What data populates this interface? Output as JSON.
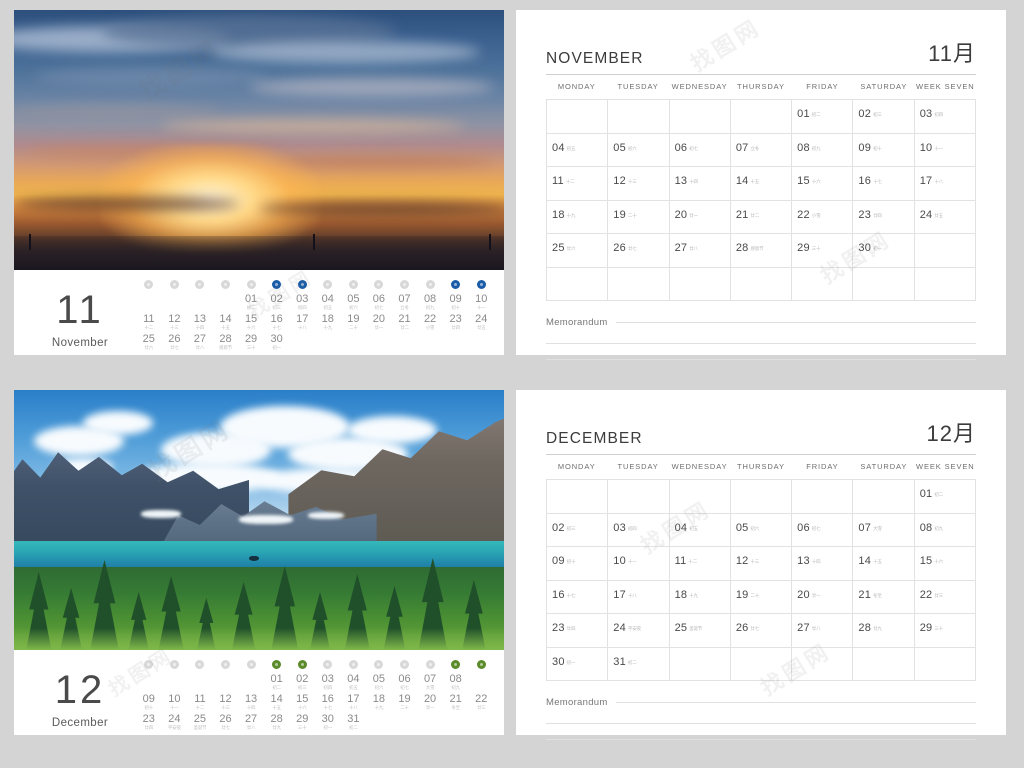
{
  "watermark": "找图网",
  "colors": {
    "november_accent": "#1a5ca8",
    "december_accent": "#5a8a2a",
    "background": "#d4d4d4",
    "page": "#ffffff",
    "text_dark": "#4a4a4a",
    "rule": "#e2e2e2"
  },
  "weekdays": [
    "MONDAY",
    "TUESDAY",
    "WEDNESDAY",
    "THURSDAY",
    "FRIDAY",
    "SATURDAY",
    "WEEK SEVEN"
  ],
  "memorandum_label": "Memorandum",
  "months": [
    {
      "key": "november",
      "number": "11",
      "name_en": "November",
      "title_en": "NOVEMBER",
      "title_cn": "11月",
      "accent": "#1a5ca8",
      "photo_alt": "sunset-sky-clouds",
      "grid_leading_blanks": 4,
      "grid_cells": [
        {
          "day": "",
          "lunar": ""
        },
        {
          "day": "",
          "lunar": ""
        },
        {
          "day": "",
          "lunar": ""
        },
        {
          "day": "",
          "lunar": ""
        },
        {
          "day": "01",
          "lunar": "初二"
        },
        {
          "day": "02",
          "lunar": "初三"
        },
        {
          "day": "03",
          "lunar": "初四"
        },
        {
          "day": "04",
          "lunar": "初五"
        },
        {
          "day": "05",
          "lunar": "初六"
        },
        {
          "day": "06",
          "lunar": "初七"
        },
        {
          "day": "07",
          "lunar": "立冬"
        },
        {
          "day": "08",
          "lunar": "初九"
        },
        {
          "day": "09",
          "lunar": "初十"
        },
        {
          "day": "10",
          "lunar": "十一"
        },
        {
          "day": "11",
          "lunar": "十二"
        },
        {
          "day": "12",
          "lunar": "十三"
        },
        {
          "day": "13",
          "lunar": "十四"
        },
        {
          "day": "14",
          "lunar": "十五"
        },
        {
          "day": "15",
          "lunar": "十六"
        },
        {
          "day": "16",
          "lunar": "十七"
        },
        {
          "day": "17",
          "lunar": "十八"
        },
        {
          "day": "18",
          "lunar": "十九"
        },
        {
          "day": "19",
          "lunar": "二十"
        },
        {
          "day": "20",
          "lunar": "廿一"
        },
        {
          "day": "21",
          "lunar": "廿二"
        },
        {
          "day": "22",
          "lunar": "小雪"
        },
        {
          "day": "23",
          "lunar": "廿四"
        },
        {
          "day": "24",
          "lunar": "廿五"
        },
        {
          "day": "25",
          "lunar": "廿六"
        },
        {
          "day": "26",
          "lunar": "廿七"
        },
        {
          "day": "27",
          "lunar": "廿八"
        },
        {
          "day": "28",
          "lunar": "感恩节"
        },
        {
          "day": "29",
          "lunar": "三十"
        },
        {
          "day": "30",
          "lunar": "初一"
        },
        {
          "day": "",
          "lunar": ""
        },
        {
          "day": "",
          "lunar": ""
        },
        {
          "day": "",
          "lunar": ""
        },
        {
          "day": "",
          "lunar": ""
        },
        {
          "day": "",
          "lunar": ""
        },
        {
          "day": "",
          "lunar": ""
        },
        {
          "day": "",
          "lunar": ""
        },
        {
          "day": "",
          "lunar": ""
        }
      ],
      "strip_dots": [
        false,
        false,
        false,
        false,
        false,
        true,
        true,
        false,
        false,
        false,
        false,
        false,
        true,
        true
      ],
      "strip_rows": [
        [
          {
            "day": "",
            "lunar": ""
          },
          {
            "day": "",
            "lunar": ""
          },
          {
            "day": "",
            "lunar": ""
          },
          {
            "day": "",
            "lunar": ""
          },
          {
            "day": "01",
            "lunar": "初二"
          },
          {
            "day": "02",
            "lunar": "初三"
          },
          {
            "day": "03",
            "lunar": "初四"
          },
          {
            "day": "04",
            "lunar": "初五"
          },
          {
            "day": "05",
            "lunar": "初六"
          },
          {
            "day": "06",
            "lunar": "初七"
          },
          {
            "day": "07",
            "lunar": "立冬"
          },
          {
            "day": "08",
            "lunar": "初九"
          },
          {
            "day": "09",
            "lunar": "初十"
          },
          {
            "day": "10",
            "lunar": "十一"
          }
        ],
        [
          {
            "day": "11",
            "lunar": "十二"
          },
          {
            "day": "12",
            "lunar": "十三"
          },
          {
            "day": "13",
            "lunar": "十四"
          },
          {
            "day": "14",
            "lunar": "十五"
          },
          {
            "day": "15",
            "lunar": "十六"
          },
          {
            "day": "16",
            "lunar": "十七"
          },
          {
            "day": "17",
            "lunar": "十八"
          },
          {
            "day": "18",
            "lunar": "十九"
          },
          {
            "day": "19",
            "lunar": "二十"
          },
          {
            "day": "20",
            "lunar": "廿一"
          },
          {
            "day": "21",
            "lunar": "廿二"
          },
          {
            "day": "22",
            "lunar": "小雪"
          },
          {
            "day": "23",
            "lunar": "廿四"
          },
          {
            "day": "24",
            "lunar": "廿五"
          }
        ],
        [
          {
            "day": "25",
            "lunar": "廿六"
          },
          {
            "day": "26",
            "lunar": "廿七"
          },
          {
            "day": "27",
            "lunar": "廿八"
          },
          {
            "day": "28",
            "lunar": "感恩节"
          },
          {
            "day": "29",
            "lunar": "三十"
          },
          {
            "day": "30",
            "lunar": "初一"
          },
          {
            "day": "",
            "lunar": ""
          },
          {
            "day": "",
            "lunar": ""
          },
          {
            "day": "",
            "lunar": ""
          },
          {
            "day": "",
            "lunar": ""
          },
          {
            "day": "",
            "lunar": ""
          },
          {
            "day": "",
            "lunar": ""
          },
          {
            "day": "",
            "lunar": ""
          },
          {
            "day": "",
            "lunar": ""
          }
        ]
      ]
    },
    {
      "key": "december",
      "number": "12",
      "name_en": "December",
      "title_en": "DECEMBER",
      "title_cn": "12月",
      "accent": "#5a8a2a",
      "photo_alt": "mountain-lake-forest",
      "grid_leading_blanks": 6,
      "grid_cells": [
        {
          "day": "",
          "lunar": ""
        },
        {
          "day": "",
          "lunar": ""
        },
        {
          "day": "",
          "lunar": ""
        },
        {
          "day": "",
          "lunar": ""
        },
        {
          "day": "",
          "lunar": ""
        },
        {
          "day": "",
          "lunar": ""
        },
        {
          "day": "01",
          "lunar": "初二"
        },
        {
          "day": "02",
          "lunar": "初三"
        },
        {
          "day": "03",
          "lunar": "初四"
        },
        {
          "day": "04",
          "lunar": "初五"
        },
        {
          "day": "05",
          "lunar": "初六"
        },
        {
          "day": "06",
          "lunar": "初七"
        },
        {
          "day": "07",
          "lunar": "大雪"
        },
        {
          "day": "08",
          "lunar": "初九"
        },
        {
          "day": "09",
          "lunar": "初十"
        },
        {
          "day": "10",
          "lunar": "十一"
        },
        {
          "day": "11",
          "lunar": "十二"
        },
        {
          "day": "12",
          "lunar": "十三"
        },
        {
          "day": "13",
          "lunar": "十四"
        },
        {
          "day": "14",
          "lunar": "十五"
        },
        {
          "day": "15",
          "lunar": "十六"
        },
        {
          "day": "16",
          "lunar": "十七"
        },
        {
          "day": "17",
          "lunar": "十八"
        },
        {
          "day": "18",
          "lunar": "十九"
        },
        {
          "day": "19",
          "lunar": "二十"
        },
        {
          "day": "20",
          "lunar": "廿一"
        },
        {
          "day": "21",
          "lunar": "冬至"
        },
        {
          "day": "22",
          "lunar": "廿三"
        },
        {
          "day": "23",
          "lunar": "廿四"
        },
        {
          "day": "24",
          "lunar": "平安夜"
        },
        {
          "day": "25",
          "lunar": "圣诞节"
        },
        {
          "day": "26",
          "lunar": "廿七"
        },
        {
          "day": "27",
          "lunar": "廿八"
        },
        {
          "day": "28",
          "lunar": "廿九"
        },
        {
          "day": "29",
          "lunar": "三十"
        },
        {
          "day": "30",
          "lunar": "初一"
        },
        {
          "day": "31",
          "lunar": "初二"
        },
        {
          "day": "",
          "lunar": ""
        },
        {
          "day": "",
          "lunar": ""
        },
        {
          "day": "",
          "lunar": ""
        },
        {
          "day": "",
          "lunar": ""
        },
        {
          "day": "",
          "lunar": ""
        }
      ],
      "strip_dots": [
        false,
        false,
        false,
        false,
        false,
        true,
        true,
        false,
        false,
        false,
        false,
        false,
        true,
        true
      ],
      "strip_rows": [
        [
          {
            "day": "",
            "lunar": ""
          },
          {
            "day": "",
            "lunar": ""
          },
          {
            "day": "",
            "lunar": ""
          },
          {
            "day": "",
            "lunar": ""
          },
          {
            "day": "",
            "lunar": ""
          },
          {
            "day": "01",
            "lunar": "初二"
          },
          {
            "day": "02",
            "lunar": "初三"
          },
          {
            "day": "03",
            "lunar": "初四"
          },
          {
            "day": "04",
            "lunar": "初五"
          },
          {
            "day": "05",
            "lunar": "初六"
          },
          {
            "day": "06",
            "lunar": "初七"
          },
          {
            "day": "07",
            "lunar": "大雪"
          },
          {
            "day": "08",
            "lunar": "初九"
          },
          {
            "day": "",
            "lunar": ""
          }
        ],
        [
          {
            "day": "09",
            "lunar": "初十"
          },
          {
            "day": "10",
            "lunar": "十一"
          },
          {
            "day": "11",
            "lunar": "十二"
          },
          {
            "day": "12",
            "lunar": "十三"
          },
          {
            "day": "13",
            "lunar": "十四"
          },
          {
            "day": "14",
            "lunar": "十五"
          },
          {
            "day": "15",
            "lunar": "十六"
          },
          {
            "day": "16",
            "lunar": "十七"
          },
          {
            "day": "17",
            "lunar": "十八"
          },
          {
            "day": "18",
            "lunar": "十九"
          },
          {
            "day": "19",
            "lunar": "二十"
          },
          {
            "day": "20",
            "lunar": "廿一"
          },
          {
            "day": "21",
            "lunar": "冬至"
          },
          {
            "day": "22",
            "lunar": "廿三"
          }
        ],
        [
          {
            "day": "23",
            "lunar": "廿四"
          },
          {
            "day": "24",
            "lunar": "平安夜"
          },
          {
            "day": "25",
            "lunar": "圣诞节"
          },
          {
            "day": "26",
            "lunar": "廿七"
          },
          {
            "day": "27",
            "lunar": "廿八"
          },
          {
            "day": "28",
            "lunar": "廿九"
          },
          {
            "day": "29",
            "lunar": "三十"
          },
          {
            "day": "30",
            "lunar": "初一"
          },
          {
            "day": "31",
            "lunar": "初二"
          },
          {
            "day": "",
            "lunar": ""
          },
          {
            "day": "",
            "lunar": ""
          },
          {
            "day": "",
            "lunar": ""
          },
          {
            "day": "",
            "lunar": ""
          },
          {
            "day": "",
            "lunar": ""
          }
        ]
      ]
    }
  ]
}
